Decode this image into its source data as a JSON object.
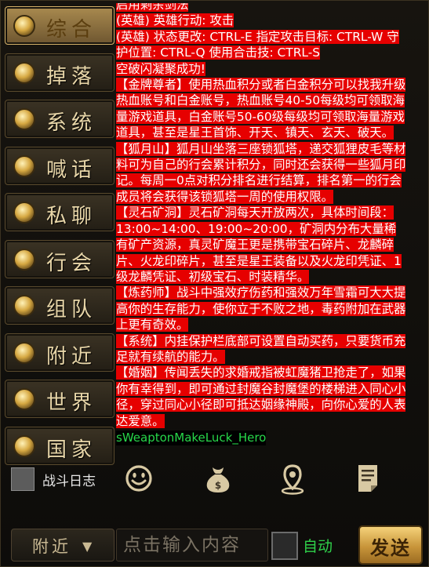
{
  "tabs": [
    {
      "label": "综合",
      "active": true
    },
    {
      "label": "掉落",
      "active": false
    },
    {
      "label": "系统",
      "active": false
    },
    {
      "label": "喊话",
      "active": false
    },
    {
      "label": "私聊",
      "active": false
    },
    {
      "label": "行会",
      "active": false
    },
    {
      "label": "组队",
      "active": false
    },
    {
      "label": "附近",
      "active": false
    },
    {
      "label": "世界",
      "active": false
    },
    {
      "label": "国家",
      "active": false
    }
  ],
  "chat": {
    "messages": [
      "启用剩余剑法",
      "(英雄) 英雄行动: 攻击",
      "(英雄) 状态更改: CTRL-E 指定攻击目标: CTRL-W 守护位置: CTRL-Q 使用合击技: CTRL-S",
      "空破闪凝聚成功!",
      "【金牌尊者】使用热血积分或者白金积分可以找我升级热血账号和白金账号，热血账号40-50每级均可领取海量游戏道具，白金账号50-60级每级均可领取海量游戏道具，甚至是星王首饰、开天、镇天、玄天、破天。",
      "【狐月山】狐月山坐落三座锁狐塔，递交狐狸皮毛等材料可为自己的行会累计积分，同时还会获得一些狐月印记。每周一0点对积分排名进行结算，排名第一的行会成员将会获得该锁狐塔一周的使用权限。",
      "【灵石矿洞】灵石矿洞每天开放两次，具体时间段：13:00~14:00、19:00~20:00，矿洞内分布大量稀有矿产资源，真灵矿魔王更是携带宝石碎片、龙麟碎片、火龙印碎片，甚至是星王装备以及火龙印凭证、1级龙麟凭证、初级宝石、时装精华。",
      "【炼药师】战斗中强效疗伤药和强效万年雪霜可大大提高你的生存能力，使你立于不败之地，毒药附加在武器上更有奇效。",
      "【系统】内挂保护栏底部可设置自动买药，只要货币充足就有续航的能力。",
      "【婚姻】传闻丢失的求婚戒指被虹魔猪卫抢走了，如果你有幸得到，即可通过封魔谷封魔堡的楼梯进入同心小径，穿过同心小径即可抵达姻缘神殿，向你心爱的人表达爱意。"
    ],
    "hero_line": "sWeaptonMakeLuck_Hero"
  },
  "toolbar": {
    "battle_log_label": "战斗日志",
    "icons": [
      "smiley-icon",
      "money-bag-icon",
      "location-pin-icon",
      "notepad-icon"
    ]
  },
  "input_bar": {
    "channel": "附近",
    "placeholder": "点击输入内容",
    "auto_label": "自动",
    "send_label": "发送"
  },
  "colors": {
    "highlight": "#e60000",
    "hero_text": "#27d84a",
    "auto_text": "#2fd04a",
    "gold": "#d6a842"
  }
}
